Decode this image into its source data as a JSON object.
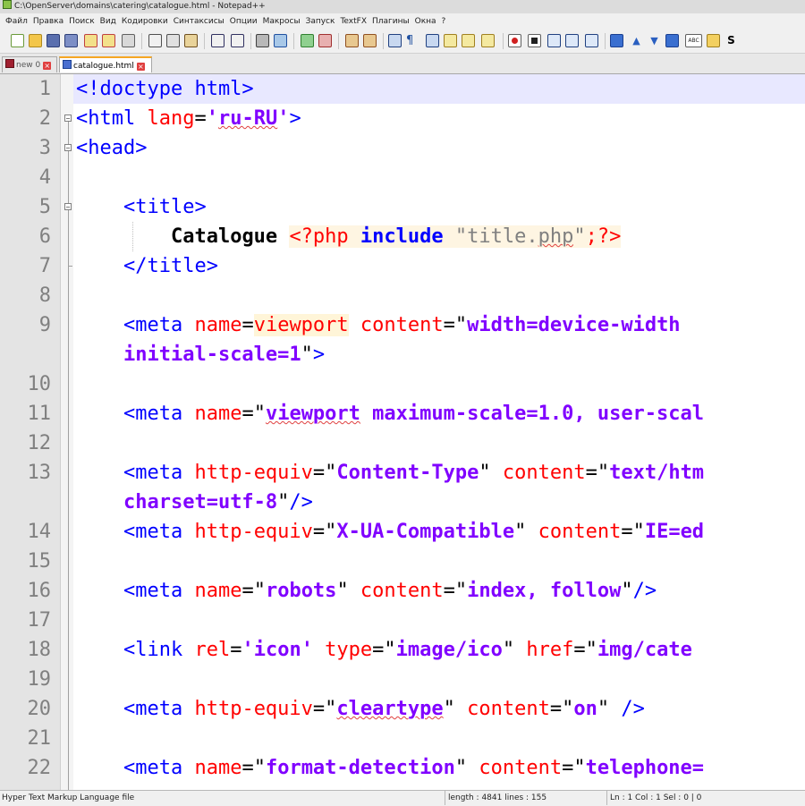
{
  "window": {
    "title": "C:\\OpenServer\\domains\\catering\\catalogue.html - Notepad++"
  },
  "menu": [
    "Файл",
    "Правка",
    "Поиск",
    "Вид",
    "Кодировки",
    "Синтаксисы",
    "Опции",
    "Макросы",
    "Запуск",
    "TextFX",
    "Плагины",
    "Окна",
    "?"
  ],
  "tabs": [
    {
      "label": "new  0",
      "active": false
    },
    {
      "label": "catalogue.html",
      "active": true
    }
  ],
  "line_numbers": [
    "1",
    "2",
    "3",
    "4",
    "5",
    "6",
    "7",
    "8",
    "9",
    "10",
    "11",
    "12",
    "13",
    "14",
    "15",
    "16",
    "17",
    "18",
    "19",
    "20",
    "21",
    "22"
  ],
  "code": {
    "l1": "<!doctype html>",
    "l2a": "<html",
    "l2b": " lang",
    "l2c": "=",
    "l2d": "'",
    "l2e": "ru-RU",
    "l2f": "'",
    "l2g": ">",
    "l3": "<head>",
    "l5": "<title>",
    "l6a": "Catalogue",
    "l6b": "<?php",
    "l6c": "include",
    "l6d": "\"title.",
    "l6e": "php",
    "l6f": "\"",
    "l6g": ";",
    "l6h": "?>",
    "l7": "</title>",
    "l9a": "<meta",
    "l9b": " name",
    "l9c": "=",
    "l9d": "viewport",
    "l9e": " content",
    "l9f": "=",
    "l9g": "\"",
    "l9h": "width=device-width",
    "l9i": "initial-scale=1",
    "l9j": "\"",
    "l9k": ">",
    "l11a": "<meta",
    "l11b": " name",
    "l11c": "=",
    "l11d": "\"",
    "l11e": "viewport",
    "l11f": " maximum-scale=1.0, user-scal",
    "l13a": "<meta",
    "l13b": " http-equiv",
    "l13c": "=",
    "l13d": "\"",
    "l13e": "Content-Type",
    "l13f": "\"",
    "l13g": " content",
    "l13h": "=",
    "l13i": "\"",
    "l13j": "text/htm",
    "l13k": "charset=utf-8",
    "l13l": "\"",
    "l13m": "/>",
    "l14a": "<meta",
    "l14b": " http-equiv",
    "l14c": "=",
    "l14d": "\"",
    "l14e": "X-UA-Compatible",
    "l14f": "\"",
    "l14g": " content",
    "l14h": "=",
    "l14i": "\"",
    "l14j": "IE=ed",
    "l16a": "<meta",
    "l16b": " name",
    "l16c": "=",
    "l16d": "\"",
    "l16e": "robots",
    "l16f": "\"",
    "l16g": " content",
    "l16h": "=",
    "l16i": "\"",
    "l16j": "index, follow",
    "l16k": "\"",
    "l16l": "/>",
    "l18a": "<link",
    "l18b": " rel",
    "l18c": "=",
    "l18d": "'",
    "l18e": "icon",
    "l18f": "'",
    "l18g": " type",
    "l18h": "=",
    "l18i": "\"",
    "l18j": "image/ico",
    "l18k": "\"",
    "l18l": " href",
    "l18m": "=",
    "l18n": "\"",
    "l18o": "img/cate",
    "l20a": "<meta",
    "l20b": " http-equiv",
    "l20c": "=",
    "l20d": "\"",
    "l20e": "cleartype",
    "l20f": "\"",
    "l20g": " content",
    "l20h": "=",
    "l20i": "\"",
    "l20j": "on",
    "l20k": "\"",
    "l20l": " />",
    "l22a": "<meta",
    "l22b": " name",
    "l22c": "=",
    "l22d": "\"",
    "l22e": "format-detection",
    "l22f": "\"",
    "l22g": " content",
    "l22h": "=",
    "l22i": "\"",
    "l22j": "telephone="
  },
  "status": {
    "filetype": "Hyper Text Markup Language file",
    "length": "length : 4841",
    "lines": "lines : 155",
    "position": "Ln : 1    Col : 1    Sel : 0 | 0"
  },
  "colors": {
    "tag": "#0000ff",
    "attribute": "#ff0000",
    "value": "#8000ff",
    "line_number": "#808080",
    "current_line": "#e8e8ff"
  }
}
